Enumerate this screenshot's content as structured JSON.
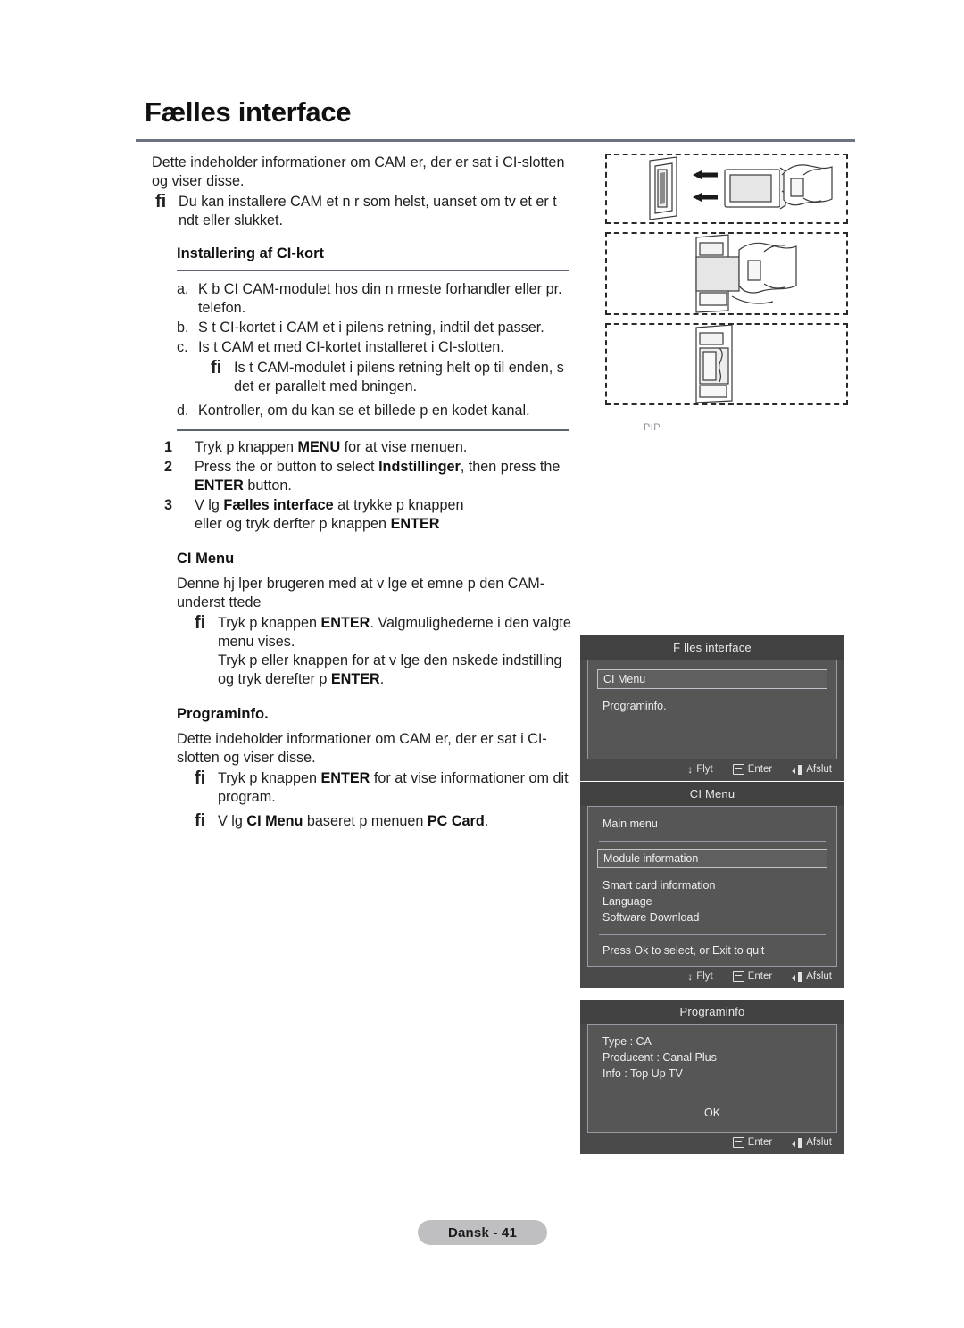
{
  "page": {
    "title": "Fælles interface",
    "footer_label": "Dansk - 41",
    "pip_label": "PIP"
  },
  "intro": {
    "paragraph": "Dette indeholder informationer om CAM er, der er sat i CI-slotten og viser disse.",
    "note": "Du kan installere CAM et n r som helst, uanset om tv et er t ndt eller slukket."
  },
  "install": {
    "heading": "Installering af CI-kort",
    "items": [
      {
        "marker": "a.",
        "text": "K b CI CAM-modulet hos din n rmeste forhandler eller pr. telefon."
      },
      {
        "marker": "b.",
        "text": "S t CI-kortet i CAM et i pilens retning, indtil det passer."
      },
      {
        "marker": "c.",
        "text": "Is t CAM et med CI-kortet installeret i CI-slotten."
      },
      {
        "marker": "d.",
        "text": "Kontroller, om du kan se et billede p  en kodet kanal."
      }
    ],
    "note_c": "Is t CAM-modulet i pilens retning helt op til enden, s  det er parallelt med  bningen."
  },
  "steps": [
    {
      "number": "1",
      "pre": "Tryk p  knappen ",
      "bold1": "MENU",
      "mid": " for at vise menuen.",
      "bold2": "",
      "post": ""
    },
    {
      "number": "2",
      "pre": "Press the  or  button to select    ",
      "bold1": "Indstillinger",
      "mid": ", then press the ",
      "bold2": "ENTER",
      "post": " button."
    },
    {
      "number": "3",
      "pre": "V lg  ",
      "bold1": "Fælles interface",
      "mid": " at trykke p  knappen",
      "bold2": "",
      "post": ""
    }
  ],
  "step3_line2": {
    "pre": " eller  og tryk derfter p  knappen      ",
    "bold": "ENTER"
  },
  "ci_menu_section": {
    "heading": "CI Menu",
    "paragraph": "Denne hj lper brugeren med at v lge et emne p  den CAM-underst ttede",
    "note1_pre": "Tryk p  knappen ",
    "note1_bold": "ENTER",
    "note1_post": ". Valgmulighederne i den valgte menu vises.",
    "note1_line2_pre": "Tryk p   eller  knappen for at v lge den  nskede indstilling og tryk derefter p  ",
    "note1_line2_bold": "ENTER",
    "note1_line2_post": "."
  },
  "programinfo_section": {
    "heading": "Programinfo.",
    "paragraph": "Dette indeholder informationer om CAM er, der er sat i CI-slotten og viser disse.",
    "note1_pre": "Tryk p  knappen ",
    "note1_bold": "ENTER",
    "note1_post": " for at vise informationer om dit program.",
    "note2_pre": "V lg  ",
    "note2_bold1": "CI Menu",
    "note2_mid": " baseret p  menuen ",
    "note2_bold2": "PC Card",
    "note2_post": "."
  },
  "illustrations": {
    "step1_caption": "cam-module-insert-into-slot",
    "step2_caption": "cam-module-pushed-in",
    "step3_caption": "cam-module-seated"
  },
  "osd_panels": [
    {
      "title": "F lles interface",
      "highlight": "CI Menu",
      "rows": [
        "Programinfo."
      ],
      "footer": [
        {
          "icon": "updown",
          "label": "Flyt"
        },
        {
          "icon": "enter",
          "label": "Enter"
        },
        {
          "icon": "exit",
          "label": "Afslut"
        }
      ]
    },
    {
      "title": "CI Menu",
      "subtitle": "Main menu",
      "highlight": "Module information",
      "rows": [
        "Smart card information",
        "Language",
        "Software Download"
      ],
      "hint": "Press Ok to select, or Exit to quit",
      "footer": [
        {
          "icon": "updown",
          "label": "Flyt"
        },
        {
          "icon": "enter",
          "label": "Enter"
        },
        {
          "icon": "exit",
          "label": "Afslut"
        }
      ]
    },
    {
      "title": "Programinfo",
      "rows": [
        "Type : CA",
        "Producent : Canal Plus",
        "Info : Top Up TV"
      ],
      "ok_label": "OK",
      "footer": [
        {
          "icon": "enter",
          "label": "Enter"
        },
        {
          "icon": "exit",
          "label": "Afslut"
        }
      ]
    }
  ],
  "colors": {
    "rule": "#6c7280",
    "osd_title_bg": "#414141",
    "osd_body_bg": "#565656",
    "footer_pill": "#bfbfc2",
    "accent_blue": "#6ea8ff"
  }
}
